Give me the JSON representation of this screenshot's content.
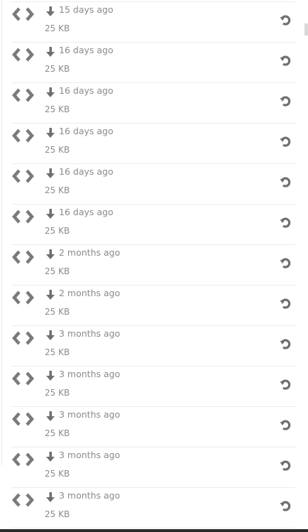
{
  "revisions": [
    {
      "when": "15 days ago",
      "size": "25 KB"
    },
    {
      "when": "16 days ago",
      "size": "25 KB"
    },
    {
      "when": "16 days ago",
      "size": "25 KB"
    },
    {
      "when": "16 days ago",
      "size": "25 KB"
    },
    {
      "when": "16 days ago",
      "size": "25 KB"
    },
    {
      "when": "16 days ago",
      "size": "25 KB"
    },
    {
      "when": "2 months ago",
      "size": "25 KB"
    },
    {
      "when": "2 months ago",
      "size": "25 KB"
    },
    {
      "when": "3 months ago",
      "size": "25 KB"
    },
    {
      "when": "3 months ago",
      "size": "25 KB"
    },
    {
      "when": "3 months ago",
      "size": "25 KB"
    },
    {
      "when": "3 months ago",
      "size": "25 KB"
    },
    {
      "when": "3 months ago",
      "size": "25 KB"
    }
  ],
  "icons": {
    "type": "code-icon",
    "download": "arrow-down-icon",
    "restore": "restore-icon"
  },
  "colors": {
    "icon": "#7a7a7a",
    "text": "#8a8a8a",
    "separator": "#ececec"
  }
}
